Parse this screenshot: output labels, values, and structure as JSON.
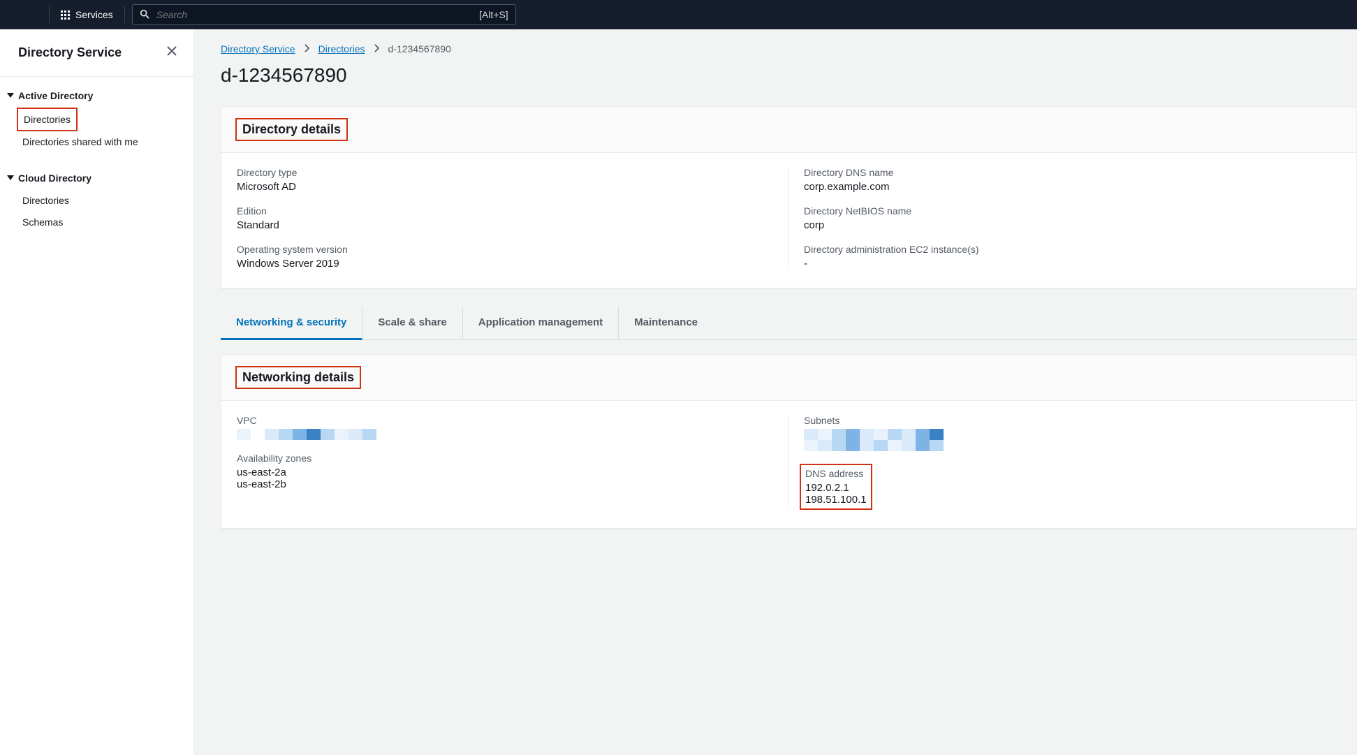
{
  "topbar": {
    "services_label": "Services",
    "search_placeholder": "Search",
    "search_kbd": "[Alt+S]"
  },
  "sidebar": {
    "title": "Directory Service",
    "sections": [
      {
        "label": "Active Directory",
        "items": [
          {
            "label": "Directories",
            "highlight": true
          },
          {
            "label": "Directories shared with me",
            "highlight": false
          }
        ]
      },
      {
        "label": "Cloud Directory",
        "items": [
          {
            "label": "Directories",
            "highlight": false
          },
          {
            "label": "Schemas",
            "highlight": false
          }
        ]
      }
    ]
  },
  "breadcrumbs": {
    "items": [
      {
        "label": "Directory Service",
        "link": true
      },
      {
        "label": "Directories",
        "link": true
      },
      {
        "label": "d-1234567890",
        "link": false
      }
    ]
  },
  "page": {
    "title": "d-1234567890"
  },
  "directory_details": {
    "panel_title": "Directory details",
    "fields": {
      "type_label": "Directory type",
      "type_value": "Microsoft AD",
      "edition_label": "Edition",
      "edition_value": "Standard",
      "os_label": "Operating system version",
      "os_value": "Windows Server 2019",
      "dns_label": "Directory DNS name",
      "dns_value": "corp.example.com",
      "netbios_label": "Directory NetBIOS name",
      "netbios_value": "corp",
      "ec2_label": "Directory administration EC2 instance(s)",
      "ec2_value": "-"
    }
  },
  "tabs": {
    "items": [
      {
        "label": "Networking & security",
        "active": true
      },
      {
        "label": "Scale & share",
        "active": false
      },
      {
        "label": "Application management",
        "active": false
      },
      {
        "label": "Maintenance",
        "active": false
      }
    ]
  },
  "networking_details": {
    "panel_title": "Networking details",
    "vpc_label": "VPC",
    "az_label": "Availability zones",
    "az_values": [
      "us-east-2a",
      "us-east-2b"
    ],
    "subnets_label": "Subnets",
    "dns_label": "DNS address",
    "dns_values": [
      "192.0.2.1",
      "198.51.100.1"
    ]
  }
}
